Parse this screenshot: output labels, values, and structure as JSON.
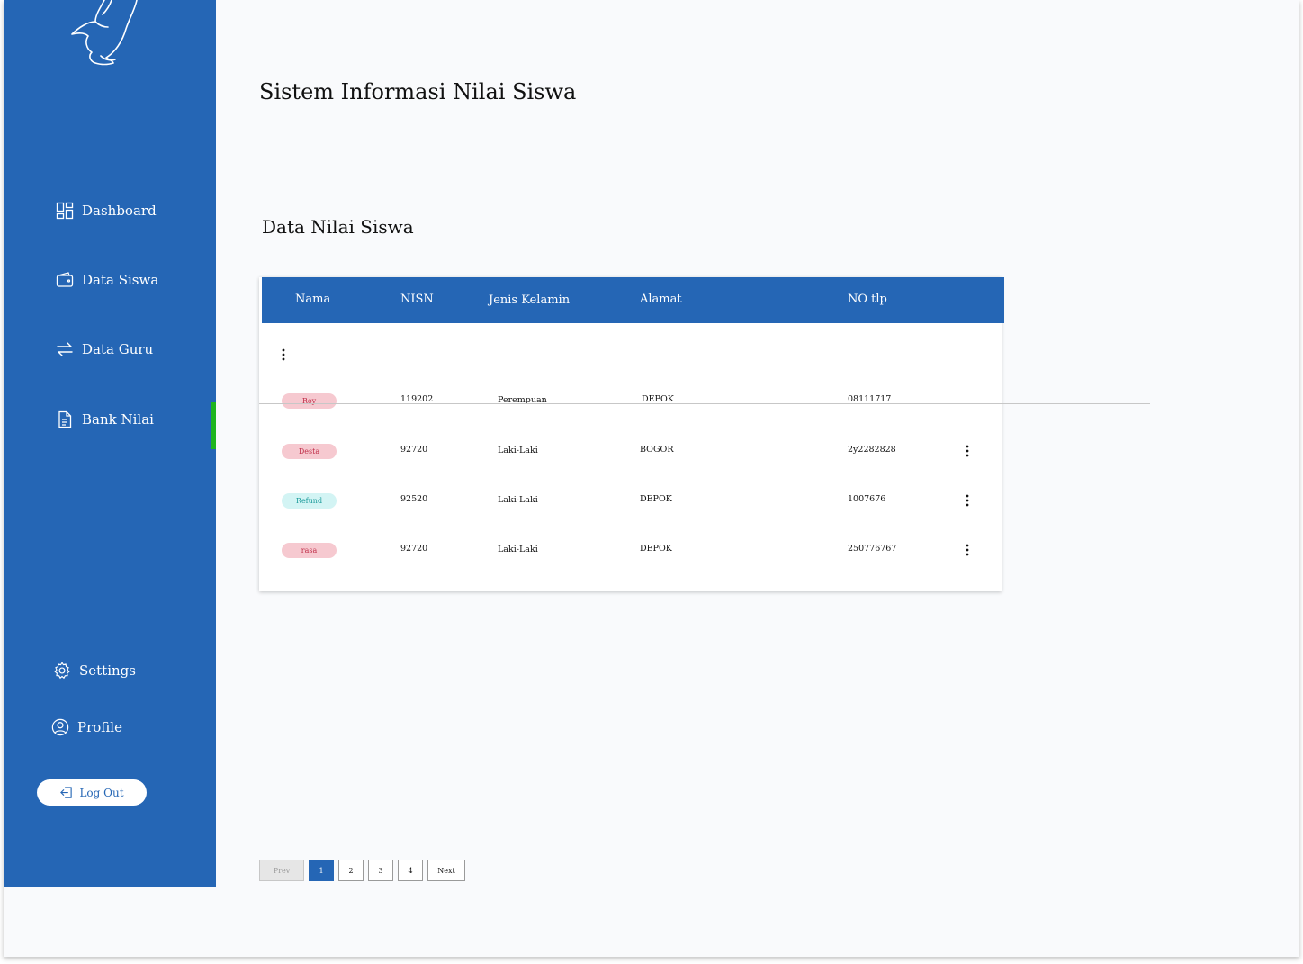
{
  "app_title": "Sistem Informasi Nilai Siswa",
  "section_title": "Data Nilai Siswa",
  "colors": {
    "primary": "#2566b5",
    "active_indicator": "#1fb51f",
    "background": "#f9fafc"
  },
  "sidebar": {
    "logo_icon": "bird-logo",
    "items": [
      {
        "label": "Dashboard",
        "icon": "dashboard-icon"
      },
      {
        "label": "Data Siswa",
        "icon": "wallet-icon"
      },
      {
        "label": "Data Guru",
        "icon": "transfer-arrows-icon"
      },
      {
        "label": "Bank Nilai",
        "icon": "document-icon",
        "active": true
      }
    ],
    "bottom": [
      {
        "label": "Settings",
        "icon": "gear-icon"
      },
      {
        "label": "Profile",
        "icon": "user-circle-icon"
      }
    ],
    "logout_label": "Log Out"
  },
  "table": {
    "headers": [
      "Nama",
      "NISN",
      "Jenis Kelamin",
      "Alamat",
      "NO tlp"
    ],
    "rows": [
      {
        "nama": "Roy",
        "nisn": "119202",
        "jenis_kelamin": "Perempuan",
        "alamat": "DEPOK",
        "no_tlp": "08111717",
        "badge_color": "#f6c9d0",
        "badge_text_color": "#c0304a"
      },
      {
        "nama": "Desta",
        "nisn": "92720",
        "jenis_kelamin": "Laki-Laki",
        "alamat": "BOGOR",
        "no_tlp": "2y2282828",
        "badge_color": "#f6c9d0",
        "badge_text_color": "#c0304a"
      },
      {
        "nama": "Refund",
        "nisn": "92520",
        "jenis_kelamin": "Laki-Laki",
        "alamat": "DEPOK",
        "no_tlp": "1007676",
        "badge_color": "#d3f4f4",
        "badge_text_color": "#1a9a9a"
      },
      {
        "nama": "rasa",
        "nisn": "92720",
        "jenis_kelamin": "Laki-Laki",
        "alamat": "DEPOK",
        "no_tlp": "250776767",
        "badge_color": "#f6c9d0",
        "badge_text_color": "#c0304a"
      }
    ]
  },
  "pagination": {
    "prev": "Prev",
    "pages": [
      "1",
      "2",
      "3",
      "4"
    ],
    "current": "1",
    "next": "Next"
  }
}
